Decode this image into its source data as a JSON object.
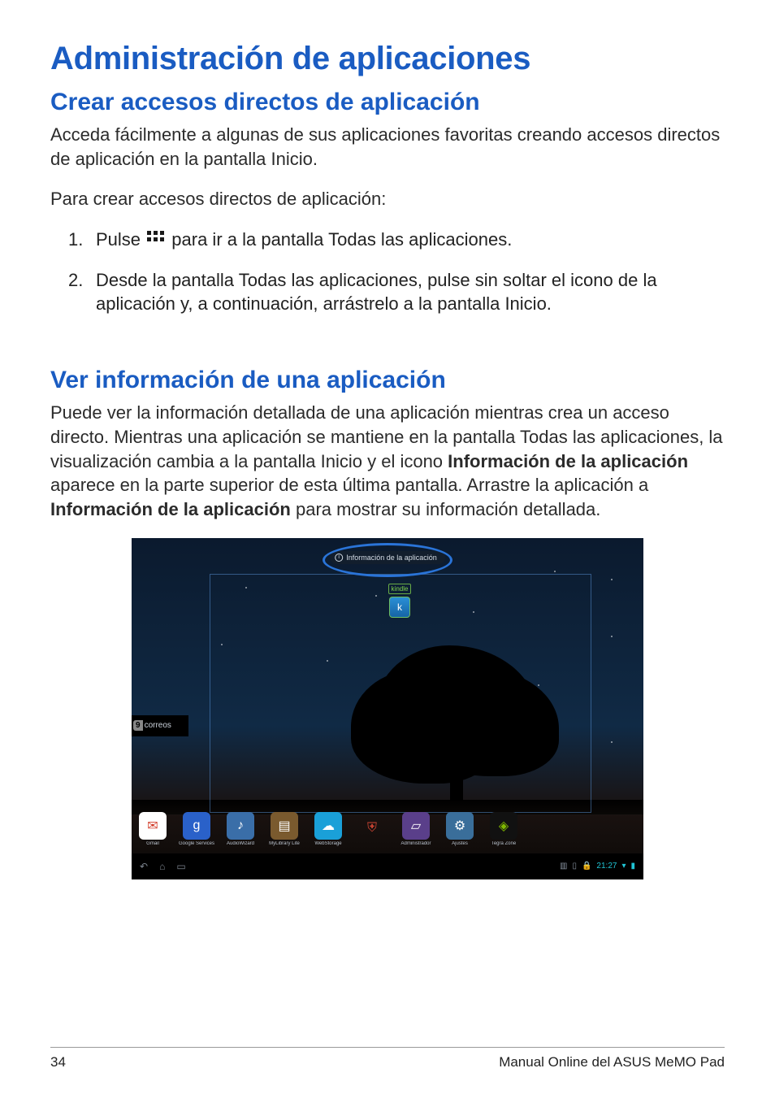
{
  "h1": "Administración de aplicaciones",
  "section1": {
    "h2": "Crear accesos directos de aplicación",
    "p1": "Acceda fácilmente a algunas de sus aplicaciones favoritas creando accesos directos de aplicación en la pantalla Inicio.",
    "p2": "Para crear accesos directos de aplicación:",
    "steps": [
      {
        "num": "1.",
        "before": "Pulse ",
        "after": " para ir a la pantalla Todas las aplicaciones."
      },
      {
        "num": "2.",
        "text": "Desde la pantalla Todas las aplicaciones, pulse sin soltar el icono de la aplicación y, a continuación, arrástrelo a la pantalla Inicio."
      }
    ]
  },
  "section2": {
    "h2": "Ver información de una aplicación",
    "p_parts": {
      "a": "Puede ver la información detallada de una aplicación mientras crea un acceso directo. Mientras una aplicación se mantiene en la pantalla Todas las aplicaciones, la visualización cambia a la pantalla Inicio y el icono ",
      "b1": "Información de la aplicación",
      "c": " aparece en la parte superior de esta última pantalla. Arrastre la aplicación a ",
      "b2": "Información de la aplicación",
      "d": " para mostrar su información detallada."
    }
  },
  "screenshot": {
    "info_pill": "Información de la aplicación",
    "kindle_label": "kindle",
    "correos": {
      "count": "9",
      "text": "correos"
    },
    "dock": [
      {
        "label": "Gmail",
        "bg": "#ffffff",
        "glyph": "✉",
        "glyphColor": "#d23c2a"
      },
      {
        "label": "Google Services",
        "bg": "#2a61c9",
        "glyph": "g"
      },
      {
        "label": "AudioWizard",
        "bg": "#3a6ea8",
        "glyph": "♪"
      },
      {
        "label": "MyLibrary Lite",
        "bg": "#7a5a2e",
        "glyph": "▤"
      },
      {
        "label": "WebStorage",
        "bg": "#1aa0d8",
        "glyph": "☁"
      },
      {
        "label": "",
        "bg": "transparent",
        "glyph": "⛨",
        "glyphColor": "#cc4433"
      },
      {
        "label": "Administrador",
        "bg": "#5a3f8a",
        "glyph": "▱"
      },
      {
        "label": "Ajustes",
        "bg": "#3a6e9a",
        "glyph": "⚙"
      },
      {
        "label": "Tegra Zone",
        "bg": "#111",
        "glyph": "◈",
        "glyphColor": "#7fb800"
      }
    ],
    "navbar": {
      "time": "21:27"
    }
  },
  "footer": {
    "page": "34",
    "title": "Manual Online del ASUS MeMO Pad"
  }
}
